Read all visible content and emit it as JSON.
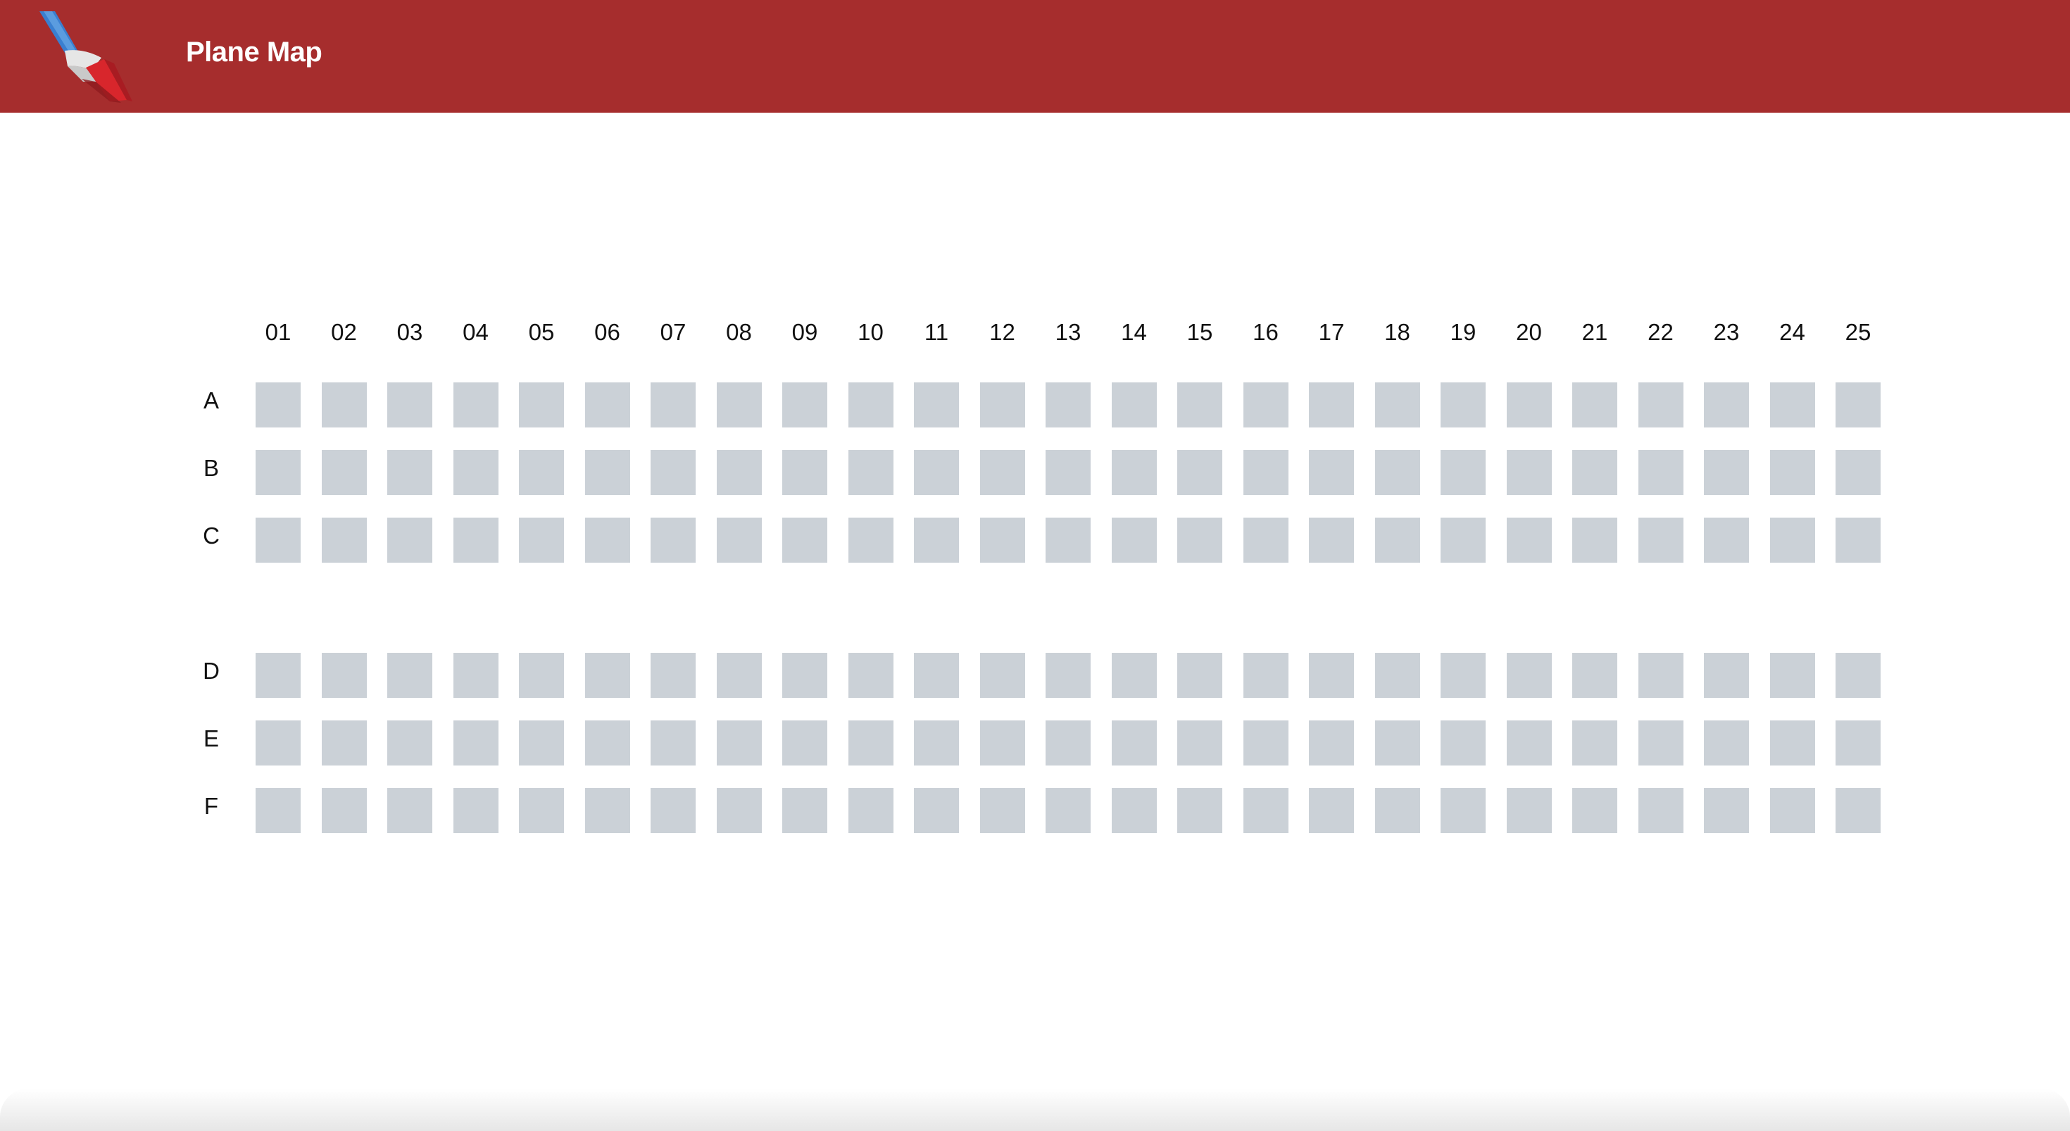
{
  "header": {
    "title": "Plane Map",
    "logo_icon": "airline-tail-logo-icon",
    "background": "#a62d2d"
  },
  "seat_map": {
    "columns": [
      "01",
      "02",
      "03",
      "04",
      "05",
      "06",
      "07",
      "08",
      "09",
      "10",
      "11",
      "12",
      "13",
      "14",
      "15",
      "16",
      "17",
      "18",
      "19",
      "20",
      "21",
      "22",
      "23",
      "24",
      "25"
    ],
    "rows": [
      "A",
      "B",
      "C",
      "D",
      "E",
      "F"
    ],
    "aisle_after_row": "C",
    "seat_color": "#cbd1d7"
  }
}
